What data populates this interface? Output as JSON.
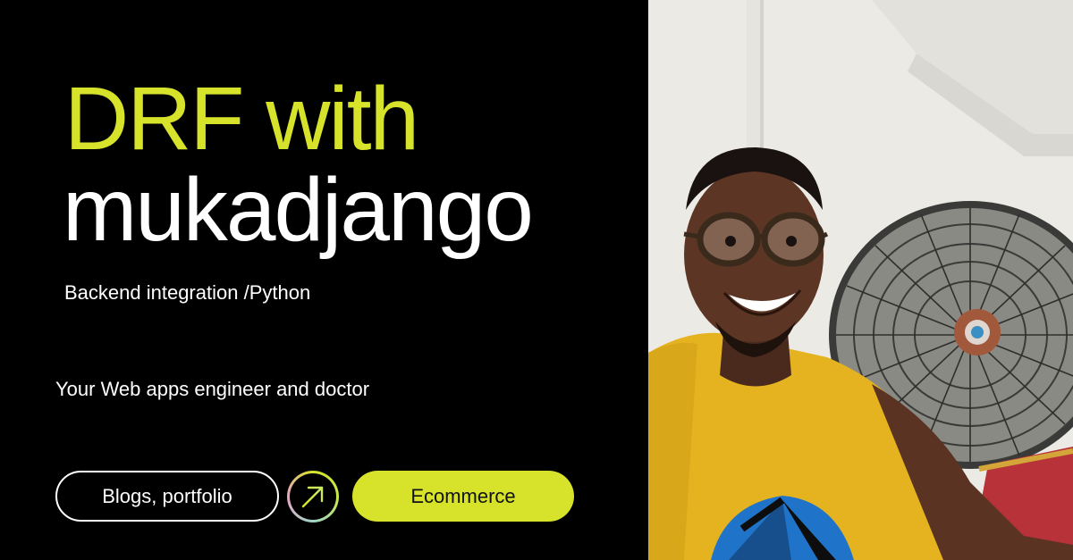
{
  "headline": {
    "line1": "DRF with",
    "line2": "mukadjango"
  },
  "subtitle": "Backend integration /Python",
  "tagline": "Your Web apps engineer and doctor",
  "buttons": {
    "blogs_label": "Blogs, portfolio",
    "arrow_icon": "arrow-up-right-icon",
    "ecommerce_label": "Ecommerce"
  },
  "colors": {
    "accent": "#d6e32a",
    "background": "#000000",
    "text": "#ffffff"
  },
  "photo": {
    "description_icon": "person-photo"
  }
}
